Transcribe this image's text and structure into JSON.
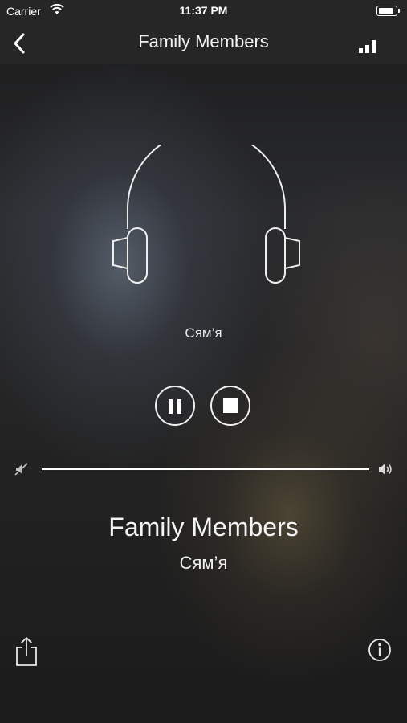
{
  "status_bar": {
    "carrier": "Carrier",
    "time": "11:37 PM",
    "battery_level": 0.9
  },
  "nav": {
    "title": "Family Members",
    "back_icon": "chevron-left-icon",
    "right_icon": "signal-bars-icon"
  },
  "player": {
    "artwork_icon": "headphones-icon",
    "artwork_caption": "Сям’я",
    "pause_icon": "pause-icon",
    "stop_icon": "stop-icon",
    "volume_level": 1.0,
    "title": "Family Members",
    "subtitle": "Сям’я"
  },
  "footer": {
    "share_icon": "share-icon",
    "info_icon": "info-icon"
  },
  "colors": {
    "bar_background": "#262626",
    "foreground": "#ffffff"
  }
}
